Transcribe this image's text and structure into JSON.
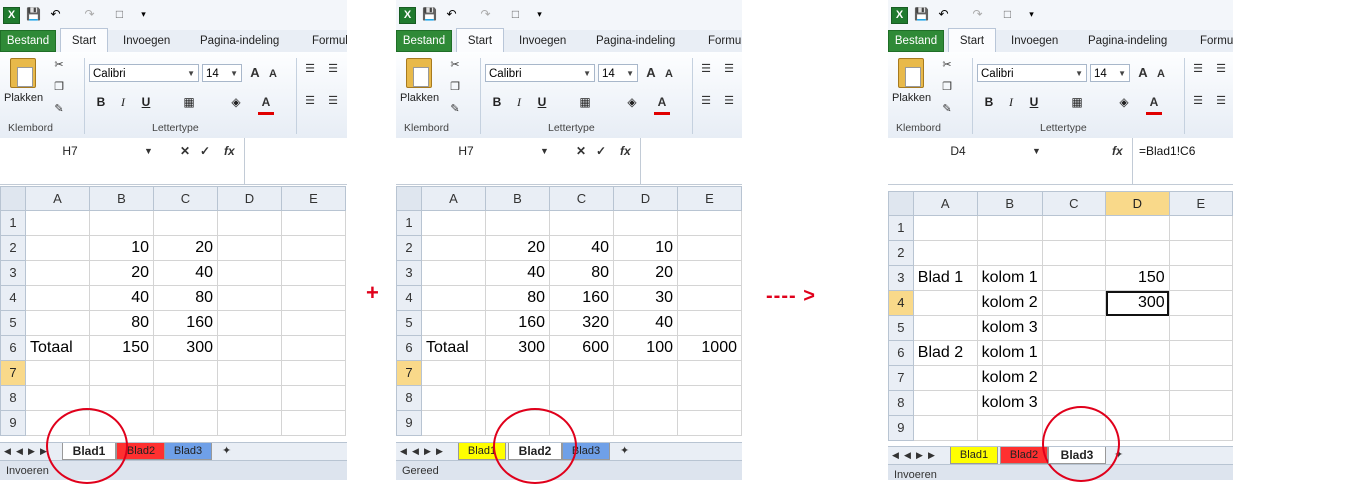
{
  "ribbon_common": {
    "tabs": [
      "Bestand",
      "Start",
      "Invoegen",
      "Pagina-indeling",
      "Formul"
    ],
    "paste_label": "Plakken",
    "font_name": "Calibri",
    "font_size": "14",
    "group_clipboard": "Klembord",
    "group_font": "Lettertype",
    "fx_label": "fx",
    "bold": "B",
    "italic": "I",
    "underline": "U",
    "grow_font": "A",
    "shrink_font": "A"
  },
  "columns": [
    "A",
    "B",
    "C",
    "D",
    "E"
  ],
  "sheet1": {
    "namebox": "H7",
    "formula": "",
    "rows": [
      {
        "n": "1",
        "cells": [
          "",
          "",
          "",
          "",
          ""
        ]
      },
      {
        "n": "2",
        "cells": [
          "",
          "10",
          "20",
          "",
          ""
        ]
      },
      {
        "n": "3",
        "cells": [
          "",
          "20",
          "40",
          "",
          ""
        ]
      },
      {
        "n": "4",
        "cells": [
          "",
          "40",
          "80",
          "",
          ""
        ]
      },
      {
        "n": "5",
        "cells": [
          "",
          "80",
          "160",
          "",
          ""
        ]
      },
      {
        "n": "6",
        "cells": [
          "Totaal",
          "150",
          "300",
          "",
          ""
        ]
      },
      {
        "n": "7",
        "cells": [
          "",
          "",
          "",
          "",
          ""
        ]
      },
      {
        "n": "8",
        "cells": [
          "",
          "",
          "",
          "",
          ""
        ]
      },
      {
        "n": "9",
        "cells": [
          "",
          "",
          "",
          "",
          ""
        ]
      }
    ],
    "sheet_tabs": [
      "Blad1",
      "Blad2",
      "Blad3"
    ],
    "active_tab": "Blad1",
    "status": "Invoeren"
  },
  "sheet2": {
    "namebox": "H7",
    "formula": "",
    "rows": [
      {
        "n": "1",
        "cells": [
          "",
          "",
          "",
          "",
          ""
        ]
      },
      {
        "n": "2",
        "cells": [
          "",
          "20",
          "40",
          "10",
          ""
        ]
      },
      {
        "n": "3",
        "cells": [
          "",
          "40",
          "80",
          "20",
          ""
        ]
      },
      {
        "n": "4",
        "cells": [
          "",
          "80",
          "160",
          "30",
          ""
        ]
      },
      {
        "n": "5",
        "cells": [
          "",
          "160",
          "320",
          "40",
          ""
        ]
      },
      {
        "n": "6",
        "cells": [
          "Totaal",
          "300",
          "600",
          "100",
          "1000"
        ]
      },
      {
        "n": "7",
        "cells": [
          "",
          "",
          "",
          "",
          ""
        ]
      },
      {
        "n": "8",
        "cells": [
          "",
          "",
          "",
          "",
          ""
        ]
      },
      {
        "n": "9",
        "cells": [
          "",
          "",
          "",
          "",
          ""
        ]
      }
    ],
    "sheet_tabs": [
      "Blad1",
      "Blad2",
      "Blad3"
    ],
    "active_tab": "Blad2",
    "status": "Gereed"
  },
  "sheet3": {
    "namebox": "D4",
    "formula": "=Blad1!C6",
    "rows": [
      {
        "n": "1",
        "cells": [
          "",
          "",
          "",
          "",
          ""
        ]
      },
      {
        "n": "2",
        "cells": [
          "",
          "",
          "",
          "",
          ""
        ]
      },
      {
        "n": "3",
        "cells": [
          "Blad 1",
          "kolom 1",
          "",
          "150",
          ""
        ]
      },
      {
        "n": "4",
        "cells": [
          "",
          "kolom 2",
          "",
          "300",
          ""
        ]
      },
      {
        "n": "5",
        "cells": [
          "",
          "kolom 3",
          "",
          "",
          ""
        ]
      },
      {
        "n": "6",
        "cells": [
          "Blad 2",
          "kolom 1",
          "",
          "",
          ""
        ]
      },
      {
        "n": "7",
        "cells": [
          "",
          "kolom 2",
          "",
          "",
          ""
        ]
      },
      {
        "n": "8",
        "cells": [
          "",
          "kolom 3",
          "",
          "",
          ""
        ]
      },
      {
        "n": "9",
        "cells": [
          "",
          "",
          "",
          "",
          ""
        ]
      }
    ],
    "sheet_tabs": [
      "Blad1",
      "Blad2",
      "Blad3"
    ],
    "active_tab": "Blad3",
    "status": "Invoeren"
  },
  "annotations": {
    "plus": "+",
    "arrow": "---- >"
  },
  "colors": {
    "file_tab": "#2f8a37",
    "annotation_red": "#e0001b",
    "tab_yellow": "#ffff00",
    "tab_red": "#ff3030",
    "tab_blue": "#6fa0e8",
    "header_highlight": "#f9d98a"
  }
}
